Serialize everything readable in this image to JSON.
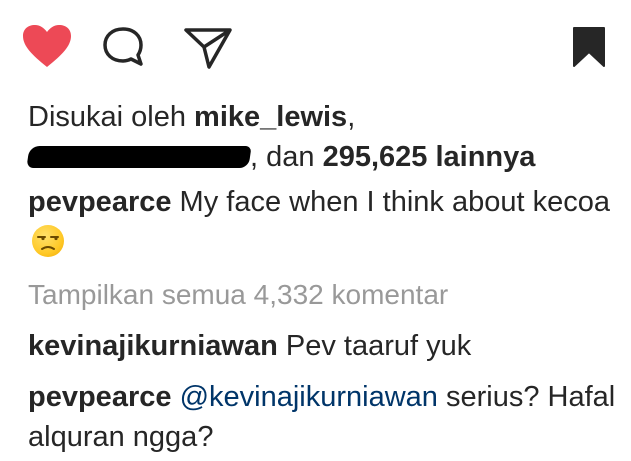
{
  "actions": {
    "like_icon": "heart-icon",
    "comment_icon": "comment-icon",
    "share_icon": "share-icon",
    "save_icon": "bookmark-icon",
    "like_color": "#ed4956"
  },
  "likes": {
    "prefix": "Disukai oleh ",
    "first_user": "mike_lewis",
    "comma": ",",
    "mid": ", dan ",
    "count_text": "295,625 lainnya"
  },
  "caption": {
    "username": "pevpearce",
    "text": " My face when I think about kecoa "
  },
  "view_all_comments": "Tampilkan semua 4,332 komentar",
  "comments": [
    {
      "username": "kevinajikurniawan",
      "text": " Pev taaruf yuk"
    },
    {
      "username": "pevpearce",
      "mention": "@kevinajikurniawan",
      "text": " serius? Hafal alquran ngga?"
    }
  ]
}
